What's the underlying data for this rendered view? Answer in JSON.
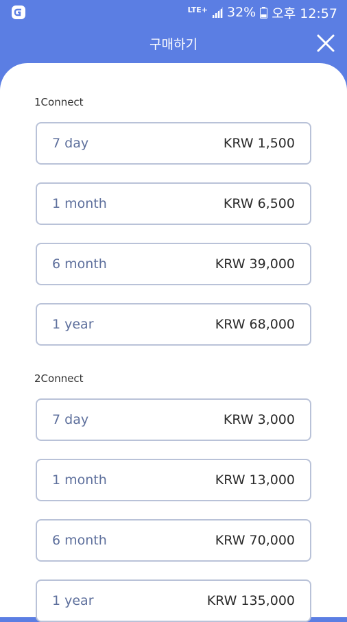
{
  "status_bar": {
    "network": "LTE+",
    "battery": "32%",
    "time": "오후 12:57",
    "icons": [
      "app-logo-icon",
      "signal-icon",
      "battery-icon"
    ]
  },
  "header": {
    "title": "구매하기",
    "close_icon": "close-icon"
  },
  "colors": {
    "accent": "#5b7ee3",
    "card_border": "#b9c2d8",
    "period_text": "#5d6f9c"
  },
  "sections": [
    {
      "label": "1Connect",
      "options": [
        {
          "period": "7 day",
          "price": "KRW 1,500"
        },
        {
          "period": "1 month",
          "price": "KRW 6,500"
        },
        {
          "period": "6 month",
          "price": "KRW 39,000"
        },
        {
          "period": "1 year",
          "price": "KRW 68,000"
        }
      ]
    },
    {
      "label": "2Connect",
      "options": [
        {
          "period": "7 day",
          "price": "KRW 3,000"
        },
        {
          "period": "1 month",
          "price": "KRW 13,000"
        },
        {
          "period": "6 month",
          "price": "KRW 70,000"
        },
        {
          "period": "1 year",
          "price": "KRW 135,000"
        }
      ]
    }
  ]
}
